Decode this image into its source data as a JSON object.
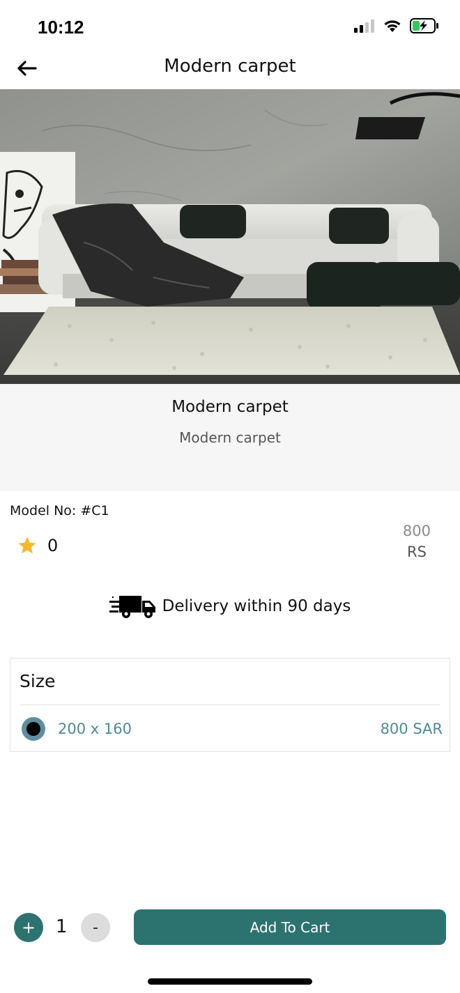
{
  "status_bar": {
    "time": "10:12"
  },
  "header": {
    "title": "Modern carpet"
  },
  "product": {
    "name": "Modern carpet",
    "subtitle": "Modern carpet",
    "model_label": "Model No: #C1",
    "rating": "0",
    "price_value": "800",
    "price_currency": "RS",
    "delivery": "Delivery within 90 days"
  },
  "size": {
    "label": "Size",
    "options": [
      {
        "name": "200 x 160",
        "price": "800 SAR",
        "selected": true
      }
    ]
  },
  "cart": {
    "plus": "+",
    "minus": "-",
    "quantity": "1",
    "add_label": "Add To Cart"
  },
  "colors": {
    "accent": "#2c7370",
    "option_text": "#4f8a95",
    "star": "#f5b82e"
  },
  "icons": [
    "back-arrow-icon",
    "signal-icon",
    "wifi-icon",
    "battery-icon",
    "star-icon",
    "delivery-truck-icon",
    "radio-selected-icon"
  ]
}
